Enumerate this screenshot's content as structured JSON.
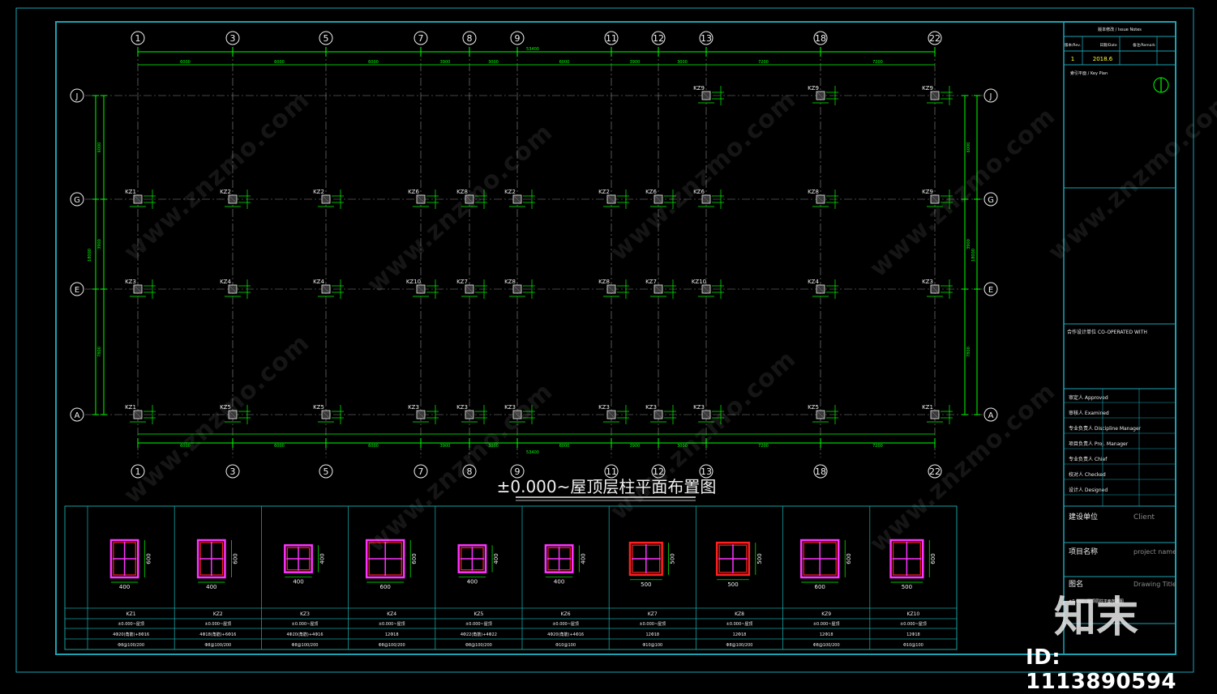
{
  "drawing": {
    "title": "±0.000~屋顶层柱平面布置图",
    "overall_dim": "53400",
    "axis_x_labels": [
      "1",
      "3",
      "5",
      "7",
      "8",
      "9",
      "11",
      "12",
      "13",
      "18",
      "22"
    ],
    "axis_x_spans": [
      "6000",
      "6000",
      "6000",
      "3900",
      "3000",
      "6000",
      "3900",
      "3000",
      "7200",
      "7200"
    ],
    "axis_y_labels": [
      "J",
      "G",
      "E",
      "A"
    ],
    "axis_y_spans": [
      "6000",
      "3900",
      "7800"
    ],
    "axis_y_total": "18000"
  },
  "column_labels": {
    "row_J": [
      {
        "col": "13",
        "kz": "KZ9"
      },
      {
        "col": "18",
        "kz": "KZ9"
      },
      {
        "col": "22",
        "kz": "KZ9"
      }
    ],
    "row_G": [
      "KZ1",
      "KZ2",
      "KZ2",
      "KZ6",
      "KZ8",
      "KZ2",
      "KZ2",
      "KZ6",
      "KZ6",
      "KZ8",
      "KZ9"
    ],
    "row_E": [
      "KZ3",
      "KZ4",
      "KZ4",
      "KZ10",
      "KZ7",
      "KZ8",
      "KZ8",
      "KZ7",
      "KZ10",
      "KZ4",
      "KZ3"
    ],
    "row_A": [
      "KZ1",
      "KZ5",
      "KZ5",
      "KZ3",
      "KZ3",
      "KZ3",
      "KZ3",
      "KZ3",
      "KZ3",
      "KZ5",
      "KZ1"
    ]
  },
  "schedule": {
    "columns": [
      {
        "name": "KZ1",
        "size_w": "400",
        "size_h": "600",
        "elev": "±0.000~屋顶",
        "rebar": "4Φ20(角筋)+8Φ16",
        "stirrup": "Φ8@100/200"
      },
      {
        "name": "KZ2",
        "size_w": "400",
        "size_h": "600",
        "elev": "±0.000~屋顶",
        "rebar": "4Φ18(角筋)+6Φ16",
        "stirrup": "Φ8@100/200"
      },
      {
        "name": "KZ3",
        "size_w": "400",
        "size_h": "400",
        "elev": "±0.000~屋顶",
        "rebar": "4Φ20(角筋)+4Φ16",
        "stirrup": "Φ8@100/200"
      },
      {
        "name": "KZ4",
        "size_w": "600",
        "size_h": "600",
        "elev": "±0.000~屋顶",
        "rebar": "12Φ18",
        "stirrup": "Φ8@100/200"
      },
      {
        "name": "KZ5",
        "size_w": "400",
        "size_h": "400",
        "elev": "±0.000~屋顶",
        "rebar": "4Φ22(角筋)+4Φ22",
        "stirrup": "Φ8@100/200"
      },
      {
        "name": "KZ6",
        "size_w": "400",
        "size_h": "400",
        "elev": "±0.000~屋顶",
        "rebar": "4Φ20(角筋)+4Φ16",
        "stirrup": "Φ10@100"
      },
      {
        "name": "KZ7",
        "size_w": "500",
        "size_h": "500",
        "elev": "±0.000~屋顶",
        "rebar": "12Φ18",
        "stirrup": "Φ10@100"
      },
      {
        "name": "KZ8",
        "size_w": "500",
        "size_h": "500",
        "elev": "±0.000~屋顶",
        "rebar": "12Φ18",
        "stirrup": "Φ8@100/200"
      },
      {
        "name": "KZ9",
        "size_w": "600",
        "size_h": "600",
        "elev": "±0.000~屋顶",
        "rebar": "12Φ18",
        "stirrup": "Φ8@100/200"
      },
      {
        "name": "KZ10",
        "size_w": "500",
        "size_h": "600",
        "elev": "±0.000~屋顶",
        "rebar": "12Φ18",
        "stirrup": "Φ10@100"
      }
    ]
  },
  "title_block": {
    "revision_header": "版本修改 / Issue Notes",
    "rev_cols": [
      "版本/Rev.",
      "日期/Date",
      "备注/Remark"
    ],
    "rev_no": "1",
    "rev_date": "2018.6",
    "keyplan": "索引平面 / Key Plan",
    "cooperated": "合作设计单位 CO-OPERATED WITH",
    "sign_rows": [
      "审定人 Approved",
      "审核人 Examined",
      "专业负责人 Discipline Manager",
      "项目负责人 Proj. Manager",
      "专业负责人 Chief",
      "校对人 Checked",
      "设计人 Designed"
    ],
    "client_label": "建设单位",
    "client_value": "Client",
    "project_label": "项目名称",
    "project_value": "project name",
    "drawing_title_label": "图名",
    "drawing_title_value": "Drawing Title",
    "drawing_title_text": "±0.000~屋顶层柱平面布置图"
  },
  "overlay": {
    "brand": "知末",
    "id": "ID: 1113890594",
    "watermark": "www.znzmo.com"
  }
}
